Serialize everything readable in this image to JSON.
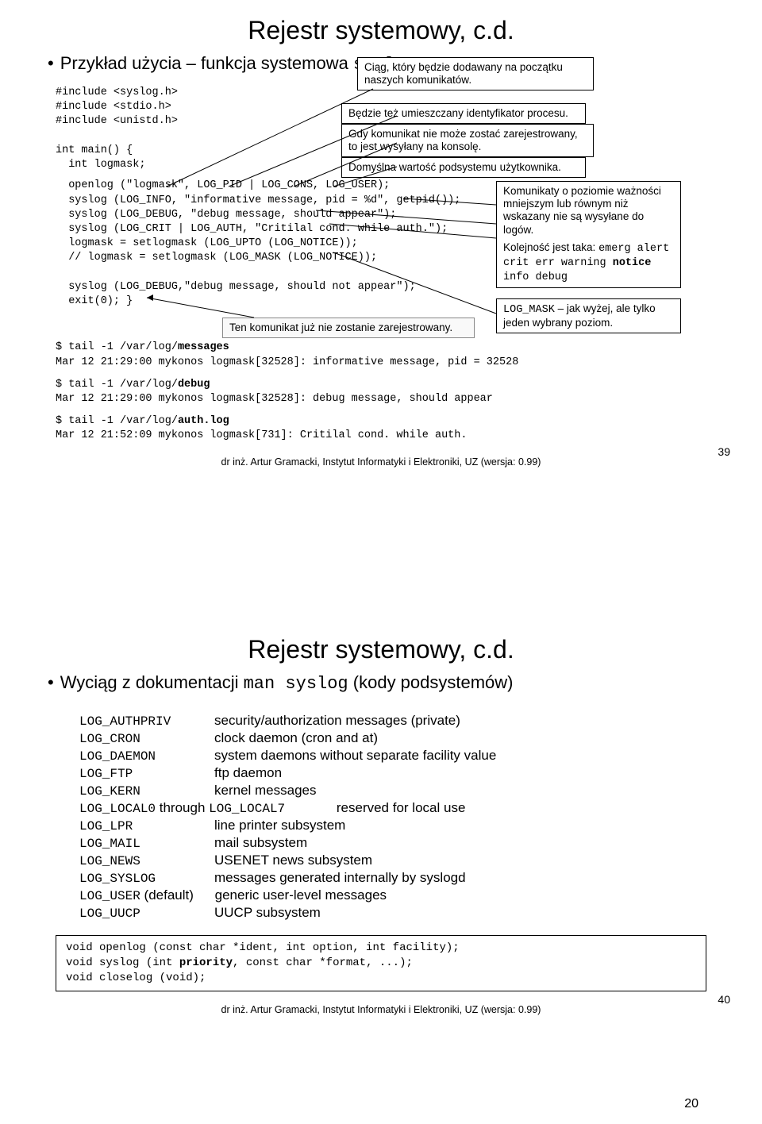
{
  "slide1": {
    "title": "Rejestr systemowy, c.d.",
    "bullet_prefix": "Przykład użycia – funkcja systemowa",
    "bullet_code": "syslog",
    "code_includes": "#include <syslog.h>\n#include <stdio.h>\n#include <unistd.h>\n\nint main() {\n  int logmask;",
    "code_body": "  openlog (\"logmask\", LOG_PID | LOG_CONS, LOG_USER);\n  syslog (LOG_INFO, \"informative message, pid = %d\", getpid());\n  syslog (LOG_DEBUG, \"debug message, should appear\");\n  syslog (LOG_CRIT | LOG_AUTH, \"Critilal cond. while auth.\");\n  logmask = setlogmask (LOG_UPTO (LOG_NOTICE));\n  // logmask = setlogmask (LOG_MASK (LOG_NOTICE));\n\n  syslog (LOG_DEBUG,\"debug message, should not appear\");\n  exit(0); }",
    "code_tail_msg": "$ tail -1 /var/log/messages\nMar 12 21:29:00 mykonos logmask[32528]: informative message, pid = 32528",
    "code_tail_msg_bold": "messages",
    "code_tail_debug": "$ tail -1 /var/log/debug\nMar 12 21:29:00 mykonos logmask[32528]: debug message, should appear",
    "code_tail_debug_bold": "debug",
    "code_tail_auth": "$ tail -1 /var/log/auth.log\nMar 12 21:52:09 mykonos logmask[731]: Critilal cond. while auth.",
    "code_tail_auth_bold": "auth.log",
    "callout_top": "Ciąg, który będzie dodawany na początku naszych komunikatów.",
    "callout_ident": "Będzie też umieszczany identyfikator procesu.",
    "callout_cons": "Gdy komunikat nie może zostać zarejestrowany, to jest wysyłany na konsolę.",
    "callout_user": "Domyślna wartość podsystemu użytkownika.",
    "callout_priority_a": "Komunikaty o poziomie ważności mniejszym lub równym niż wskazany nie są wysyłane do logów.",
    "callout_priority_b1": "Kolejność jest taka:",
    "callout_priority_b2": "emerg alert crit err warning notice info debug",
    "callout_priority_b2_bold": "notice",
    "callout_mask_a": "LOG_MASK",
    "callout_mask_b": " – jak wyżej, ale tylko jeden wybrany poziom.",
    "callout_notreg": "Ten komunikat już nie zostanie zarejestrowany.",
    "footer": "dr inż. Artur Gramacki, Instytut Informatyki i Elektroniki, UZ (wersja: 0.99)",
    "pagenum": "39"
  },
  "slide2": {
    "title": "Rejestr systemowy, c.d.",
    "bullet_prefix": "Wyciąg z dokumentacji",
    "bullet_code": "man syslog",
    "bullet_suffix": "(kody podsystemów)",
    "facilities": [
      [
        "LOG_AUTHPRIV",
        "security/authorization messages (private)"
      ],
      [
        "LOG_CRON",
        "clock daemon (cron and at)"
      ],
      [
        "LOG_DAEMON",
        "system daemons without separate facility value"
      ],
      [
        "LOG_FTP",
        "ftp daemon"
      ],
      [
        "LOG_KERN",
        "kernel messages"
      ]
    ],
    "local_row_a": "LOG_LOCAL0",
    "local_row_mid": " through ",
    "local_row_b": "LOG_LOCAL7",
    "local_row_desc": "reserved for local use",
    "facilities2": [
      [
        "LOG_LPR",
        "line printer subsystem"
      ],
      [
        "LOG_MAIL",
        "mail subsystem"
      ],
      [
        "LOG_NEWS",
        "USENET news subsystem"
      ],
      [
        "LOG_SYSLOG",
        "messages generated internally by syslogd"
      ]
    ],
    "user_row_a": "LOG_USER",
    "user_row_mid": " (default)",
    "user_row_desc": "generic user-level messages",
    "uucp_row_a": "LOG_UUCP",
    "uucp_row_desc": "UUCP subsystem",
    "proto_box": "void openlog (const char *ident, int option, int facility);\nvoid syslog (int priority, const char *format, ...);\nvoid closelog (void);",
    "proto_bold": "priority",
    "footer": "dr inż. Artur Gramacki, Instytut Informatyki i Elektroniki, UZ (wersja: 0.99)",
    "pagenum": "40"
  },
  "subpage_num": "20"
}
